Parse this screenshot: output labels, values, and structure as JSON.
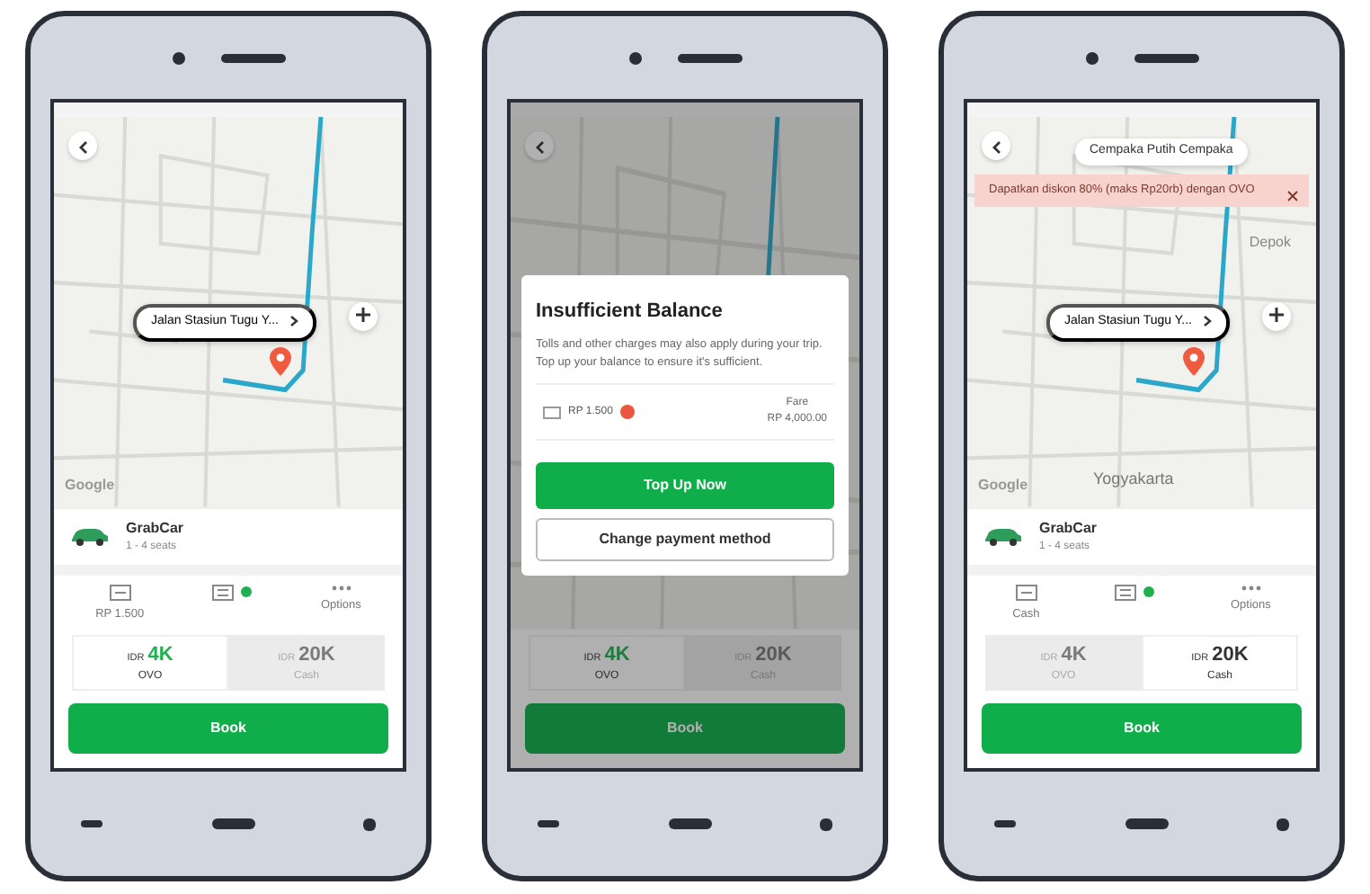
{
  "phones": [
    {
      "dimmed": false,
      "location": "Jalan Stasiun Tugu Y...",
      "map_labels": [
        {
          "kind": "logo",
          "text": "Google"
        }
      ],
      "ride": {
        "name": "GrabCar",
        "seats": "1 - 4 seats"
      },
      "payments": [
        {
          "kind": "card",
          "label": "RP 1.500"
        },
        {
          "kind": "promo"
        },
        {
          "kind": "dots",
          "label": "Options"
        }
      ],
      "fares": [
        {
          "currency": "IDR",
          "amount": "4K",
          "method": "OVO",
          "selected": true
        },
        {
          "currency": "IDR",
          "amount": "20K",
          "method": "Cash",
          "selected": false
        }
      ],
      "book": "Book"
    },
    {
      "dimmed": true,
      "dialog": {
        "title": "Insufficient Balance",
        "text": "Tolls and other charges may also apply during your trip. Top up your balance to ensure it's sufficient.",
        "balance": "RP 1.500",
        "fare_label": "Fare",
        "fare": "RP 4,000.00",
        "primary": "Top Up Now",
        "secondary": "Change payment method"
      },
      "fares": [
        {
          "currency": "IDR",
          "amount": "4K",
          "method": "OVO",
          "selected": true
        },
        {
          "currency": "IDR",
          "amount": "20K",
          "method": "Cash",
          "selected": false
        }
      ],
      "book": "Book"
    },
    {
      "dimmed": false,
      "destination": "Cempaka Putih Cempaka",
      "banner": "Dapatkan diskon 80% (maks Rp20rb) dengan OVO",
      "location": "Jalan Stasiun Tugu Y...",
      "map_labels": [
        {
          "kind": "area",
          "text": "Depok"
        },
        {
          "kind": "city",
          "text": "Yogyakarta"
        },
        {
          "kind": "logo",
          "text": "Google"
        }
      ],
      "ride": {
        "name": "GrabCar",
        "seats": "1 - 4 seats"
      },
      "payments": [
        {
          "kind": "card",
          "label": "Cash"
        },
        {
          "kind": "promo"
        },
        {
          "kind": "dots",
          "label": "Options"
        }
      ],
      "fares": [
        {
          "currency": "IDR",
          "amount": "4K",
          "method": "OVO",
          "selected": false
        },
        {
          "currency": "IDR",
          "amount": "20K",
          "method": "Cash",
          "selected": true
        }
      ],
      "book": "Book"
    }
  ]
}
